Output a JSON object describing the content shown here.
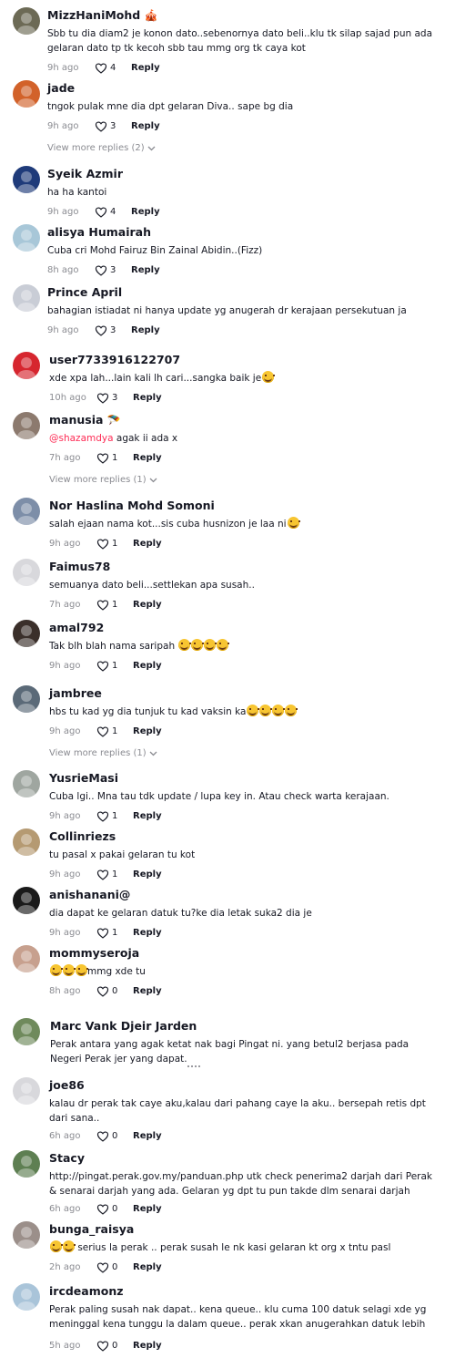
{
  "comments": [
    {
      "username": "MizzHaniMohd",
      "flair": "🎪",
      "text": "Sbb tu dia diam2 je konon dato..sebenornya dato beli..klu tk silap sajad pun ada gelaran dato tp tk kecoh sbb tau mmg org tk caya kot",
      "time": "9h ago",
      "likes": "4",
      "reply": "Reply",
      "avatar_color": "#6c6a55"
    },
    {
      "username": "jade",
      "text": "tngok pulak mne dia dpt gelaran Diva.. sape bg dia",
      "time": "9h ago",
      "likes": "3",
      "reply": "Reply",
      "avatar_color": "#d2622a",
      "more_replies": "View more replies (2)"
    },
    {
      "username": "Syeik Azmir",
      "text": "ha ha kantoi",
      "time": "9h ago",
      "likes": "4",
      "reply": "Reply",
      "avatar_color": "#1f3b7a"
    },
    {
      "username": "alisya Humairah",
      "text": "Cuba cri Mohd Fairuz Bin Zainal Abidin..(Fizz)",
      "time": "8h ago",
      "likes": "3",
      "reply": "Reply",
      "avatar_color": "#a8c7d8"
    },
    {
      "username": "Prince April",
      "text": "bahagian istiadat ni hanya update yg anugerah dr kerajaan persekutuan ja",
      "time": "9h ago",
      "likes": "3",
      "reply": "Reply",
      "avatar_color": "#c9cdd6"
    },
    {
      "username": "user7733916122707",
      "text": "xde xpa lah...lain kali lh cari...sangka baik je",
      "emoji_count": 1,
      "time": "10h ago",
      "likes": "3",
      "reply": "Reply",
      "avatar_color": "#d6262f"
    },
    {
      "username": "manusia",
      "flair": "🪂",
      "mention": "@shazamdya",
      "text": " agak ii ada x",
      "time": "7h ago",
      "likes": "1",
      "reply": "Reply",
      "avatar_color": "#8c7a6e",
      "more_replies": "View more replies (1)"
    },
    {
      "username": "Nor Haslina Mohd Somoni",
      "text": "salah ejaan nama kot...sis cuba husnizon je laa ni",
      "emoji_count": 1,
      "time": "9h ago",
      "likes": "1",
      "reply": "Reply",
      "avatar_color": "#7d8ea8"
    },
    {
      "username": "Faimus78",
      "text": "semuanya dato beli...settlekan apa susah..",
      "time": "7h ago",
      "likes": "1",
      "reply": "Reply",
      "avatar_color": "#d8d8dc"
    },
    {
      "username": "amal792",
      "text": "Tak blh blah nama saripah ",
      "emoji_count": 4,
      "time": "9h ago",
      "likes": "1",
      "reply": "Reply",
      "avatar_color": "#3a2f2a"
    },
    {
      "username": "jambree",
      "text": "hbs tu kad yg dia tunjuk tu kad vaksin ka",
      "emoji_count": 4,
      "time": "9h ago",
      "likes": "1",
      "reply": "Reply",
      "avatar_color": "#5b6a78",
      "more_replies": "View more replies (1)"
    },
    {
      "username": "YusrieMasi",
      "text": "Cuba lgi.. Mna tau tdk update / lupa key in. Atau check warta kerajaan.",
      "time": "9h ago",
      "likes": "1",
      "reply": "Reply",
      "avatar_color": "#9fa6a0"
    },
    {
      "username": "Collinriezs",
      "text": "tu pasal x pakai gelaran tu kot",
      "time": "9h ago",
      "likes": "1",
      "reply": "Reply",
      "avatar_color": "#b59a72"
    },
    {
      "username": "anishanani@",
      "text": "dia dapat ke gelaran datuk tu?ke dia letak suka2 dia je",
      "time": "9h ago",
      "likes": "1",
      "reply": "Reply",
      "avatar_color": "#1a1a1a"
    },
    {
      "username": "mommyseroja",
      "text": "mmg xde tu",
      "emoji_prefix": 3,
      "time": "8h ago",
      "likes": "0",
      "reply": "Reply",
      "avatar_color": "#c7a08e"
    },
    {
      "username": "Marc Vank Djeir Jarden",
      "text": "Perak antara yang agak ketat nak bagi Pingat ni. yang betul2 berjasa pada Negeri Perak jer yang dapat.",
      "time": "",
      "likes": "",
      "reply": "",
      "avatar_color": "#6f8a5c"
    },
    {
      "username": "joe86",
      "text": "kalau dr perak tak caye aku,kalau dari pahang caye la aku.. bersepah retis dpt dari sana..",
      "time": "6h ago",
      "likes": "0",
      "reply": "Reply",
      "avatar_color": "#d8d8dc"
    },
    {
      "username": "Stacy",
      "text": "http://pingat.perak.gov.my/panduan.php utk check penerima2 darjah dari Perak & senarai darjah yang ada. Gelaran yg dpt tu pun takde dlm senarai darjah",
      "time": "6h ago",
      "likes": "0",
      "reply": "Reply",
      "avatar_color": "#5e7f52"
    },
    {
      "username": "bunga_raisya",
      "text": " serius la perak .. perak susah le nk kasi gelaran kt org x tntu pasl",
      "emoji_prefix": 2,
      "time": "2h ago",
      "likes": "0",
      "reply": "Reply",
      "avatar_color": "#9b8f8a"
    },
    {
      "username": "ircdeamonz",
      "text": "Perak paling susah nak dapat.. kena queue.. klu cuma 100 datuk selagi xde yg meninggal kena tunggu la dalam queue.. perak xkan anugerahkan datuk lebih",
      "time": "5h ago",
      "likes": "0",
      "reply": "Reply",
      "avatar_color": "#a9c4d9"
    }
  ]
}
